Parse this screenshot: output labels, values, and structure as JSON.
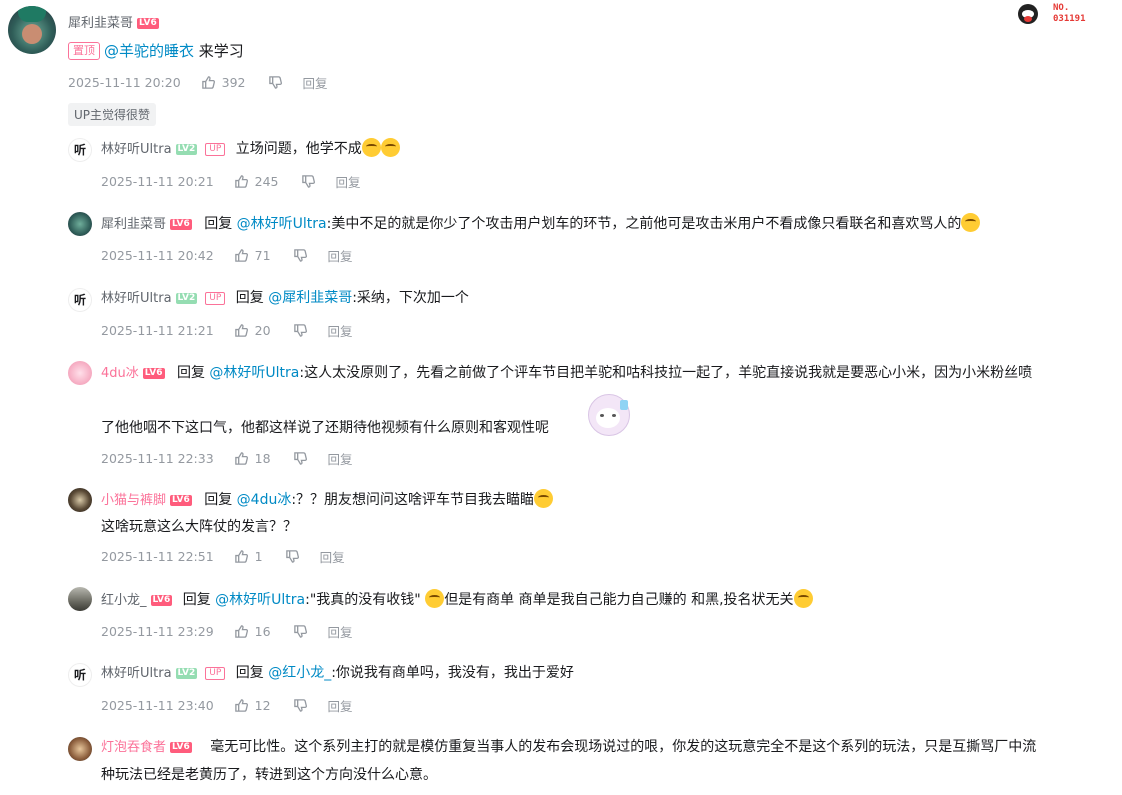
{
  "main_comment": {
    "username": "犀利韭菜哥",
    "level": "LV6",
    "pinned_tag": "置顶",
    "mention": "@羊驼的睡衣",
    "text": "来学习",
    "time": "2025-11-11 20:20",
    "likes": "392",
    "reply_label": "回复",
    "up_liked": "UP主觉得很赞",
    "medal_no": "NO.",
    "medal_num": "031191"
  },
  "replies": [
    {
      "username": "林好听Ultra",
      "level": "LV2",
      "up": "UP",
      "prefix": "",
      "mention": "",
      "text": "立场问题，他学不成",
      "time": "2025-11-11 20:21",
      "likes": "245",
      "reply_label": "回复"
    },
    {
      "username": "犀利韭菜哥",
      "level": "LV6",
      "up": "",
      "prefix": "回复",
      "mention": "@林好听Ultra",
      "text": ":美中不足的就是你少了个攻击用户划车的环节，之前他可是攻击米用户不看成像只看联名和喜欢骂人的",
      "time": "2025-11-11 20:42",
      "likes": "71",
      "reply_label": "回复"
    },
    {
      "username": "林好听Ultra",
      "level": "LV2",
      "up": "UP",
      "prefix": "回复",
      "mention": "@犀利韭菜哥",
      "text": ":采纳，下次加一个",
      "time": "2025-11-11 21:21",
      "likes": "20",
      "reply_label": "回复"
    },
    {
      "username": "4du冰",
      "level": "LV6",
      "up": "",
      "prefix": "回复",
      "mention": "@林好听Ultra",
      "text": ":这人太没原则了，先看之前做了个评车节目把羊驼和咕科技拉一起了，羊驼直接说我就是要恶心小米，因为小米粉丝喷",
      "text2": "了他他咽不下这口气，他都这样说了还期待他视频有什么原则和客观性呢",
      "time": "2025-11-11 22:33",
      "likes": "18",
      "reply_label": "回复"
    },
    {
      "username": "小猫与裤脚",
      "level": "LV6",
      "up": "",
      "prefix": "回复",
      "mention": "@4du冰",
      "text": ":？？朋友想问问这啥评车节目我去瞄瞄",
      "text2": "这啥玩意这么大阵仗的发言？？",
      "time": "2025-11-11 22:51",
      "likes": "1",
      "reply_label": "回复"
    },
    {
      "username": "红小龙_",
      "level": "LV6",
      "up": "",
      "prefix": "回复",
      "mention": "@林好听Ultra",
      "text": ":\"我真的没有收钱\"",
      "text_b": "但是有商单 商单是我自己能力自己赚的 和黑,投名状无关",
      "time": "2025-11-11 23:29",
      "likes": "16",
      "reply_label": "回复"
    },
    {
      "username": "林好听Ultra",
      "level": "LV2",
      "up": "UP",
      "prefix": "回复",
      "mention": "@红小龙_",
      "text": ":你说我有商单吗，我没有，我出于爱好",
      "time": "2025-11-11 23:40",
      "likes": "12",
      "reply_label": "回复"
    },
    {
      "username": "灯泡吞食者",
      "level": "LV6",
      "up": "",
      "prefix": "",
      "mention": "",
      "text": "毫无可比性。这个系列主打的就是模仿重复当事人的发布会现场说过的哏，你发的这玩意完全不是这个系列的玩法，只是互撕骂厂中流",
      "text2": "种玩法已经是老黄历了，转进到这个方向没什么心意。"
    }
  ],
  "colors": {
    "pink": "#fb7299",
    "link": "#008ac5",
    "gray": "#9499a0",
    "lv6": "#ff5c7c",
    "lv2": "#95ddb2"
  }
}
